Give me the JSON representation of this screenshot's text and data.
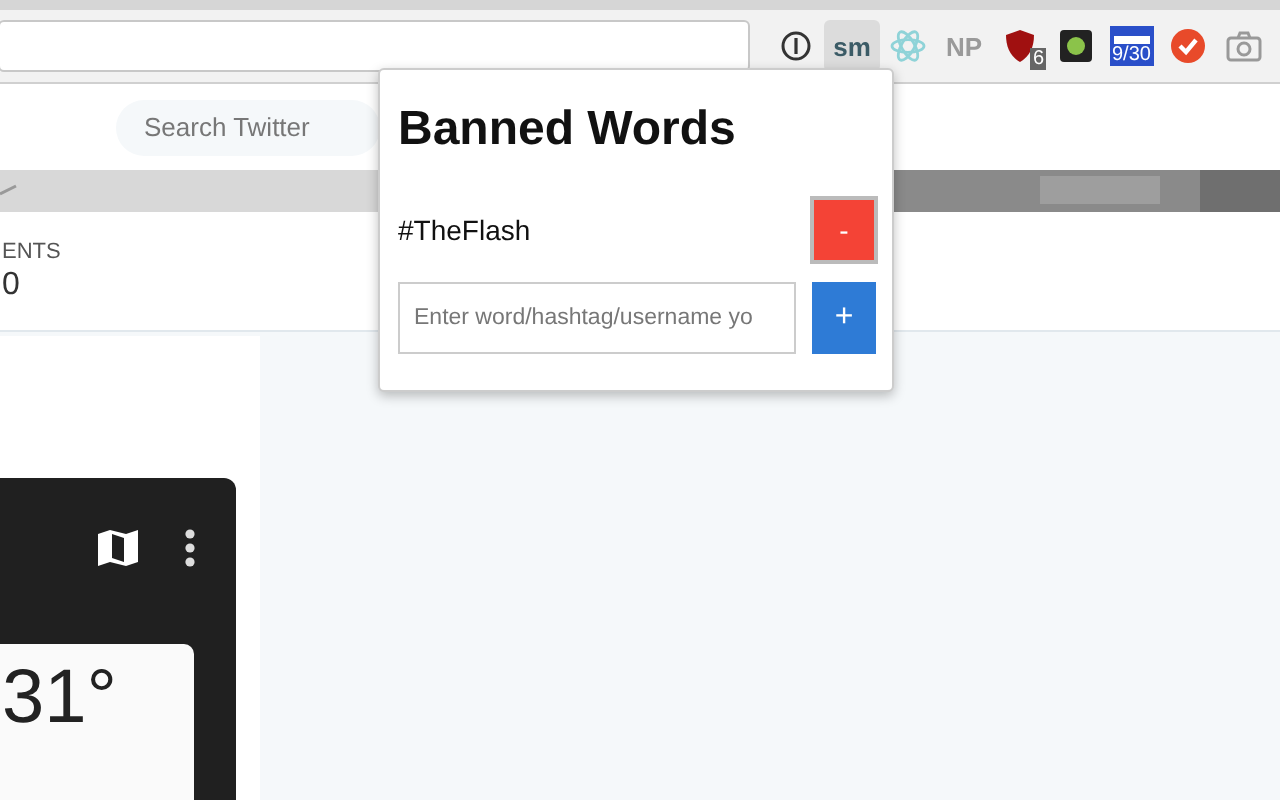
{
  "toolbar": {
    "extensions": [
      {
        "kind": "info",
        "selected": false
      },
      {
        "kind": "text",
        "label": "sm",
        "selected": true
      },
      {
        "kind": "atom",
        "selected": false
      },
      {
        "kind": "text",
        "label": "NP",
        "selected": false
      },
      {
        "kind": "shield",
        "badge": "6",
        "selected": false
      },
      {
        "kind": "square",
        "selected": false
      },
      {
        "kind": "calendar",
        "badge": "9/30",
        "selected": false
      },
      {
        "kind": "check",
        "selected": false
      },
      {
        "kind": "camera",
        "selected": false
      }
    ]
  },
  "page": {
    "search": {
      "placeholder": "Search Twitter"
    },
    "stat": {
      "label": "ENTS",
      "value": "0"
    },
    "weather": {
      "temperature": "31°"
    }
  },
  "popup": {
    "title": "Banned Words",
    "words": [
      {
        "text": "#TheFlash",
        "remove_label": "-"
      }
    ],
    "input": {
      "placeholder": "Enter word/hashtag/username yo"
    },
    "add_label": "+"
  }
}
